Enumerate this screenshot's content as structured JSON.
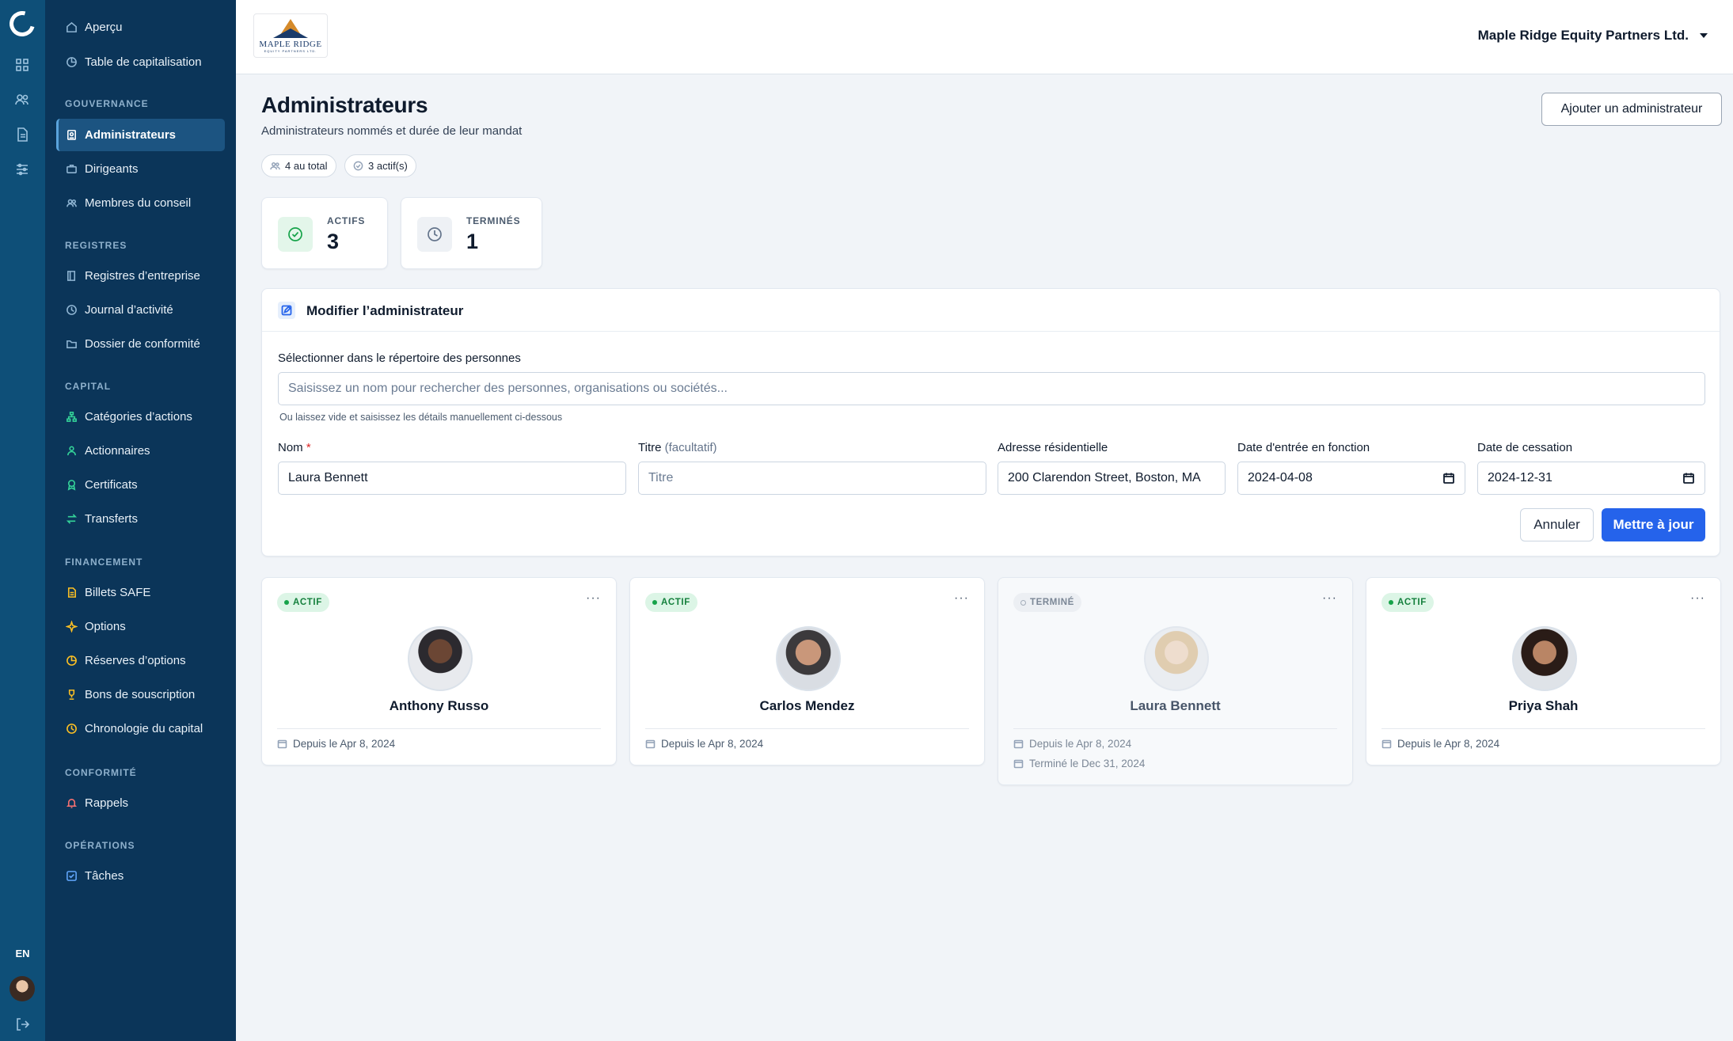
{
  "rail": {
    "lang": "EN"
  },
  "sidebar": {
    "top_items": [
      {
        "label": "Aperçu",
        "icon": "home-icon"
      },
      {
        "label": "Table de capitalisation",
        "icon": "pie-chart-icon"
      }
    ],
    "sections": [
      {
        "title": "GOUVERNANCE",
        "items": [
          {
            "label": "Administrateurs",
            "icon": "id-badge-icon",
            "active": true
          },
          {
            "label": "Dirigeants",
            "icon": "briefcase-icon"
          },
          {
            "label": "Membres du conseil",
            "icon": "users-icon"
          }
        ]
      },
      {
        "title": "REGISTRES",
        "items": [
          {
            "label": "Registres d’entreprise",
            "icon": "book-icon"
          },
          {
            "label": "Journal d’activité",
            "icon": "clock-icon"
          },
          {
            "label": "Dossier de conformité",
            "icon": "folder-icon"
          }
        ]
      },
      {
        "title": "CAPITAL",
        "items": [
          {
            "label": "Catégories d’actions",
            "icon": "hierarchy-icon"
          },
          {
            "label": "Actionnaires",
            "icon": "user-group-icon"
          },
          {
            "label": "Certificats",
            "icon": "award-icon"
          },
          {
            "label": "Transferts",
            "icon": "transfer-icon"
          }
        ]
      },
      {
        "title": "FINANCEMENT",
        "items": [
          {
            "label": "Billets SAFE",
            "icon": "document-icon"
          },
          {
            "label": "Options",
            "icon": "sparkle-icon"
          },
          {
            "label": "Réserves d’options",
            "icon": "pie-chart-icon"
          },
          {
            "label": "Bons de souscription",
            "icon": "trophy-icon"
          },
          {
            "label": "Chronologie du capital",
            "icon": "clock-icon"
          }
        ]
      },
      {
        "title": "CONFORMITÉ",
        "items": [
          {
            "label": "Rappels",
            "icon": "bell-icon"
          }
        ]
      },
      {
        "title": "OPÉRATIONS",
        "items": [
          {
            "label": "Tâches",
            "icon": "checkbox-icon"
          }
        ]
      }
    ]
  },
  "topbar": {
    "logo_text": "MAPLE RIDGE",
    "logo_subtext": "EQUITY PARTNERS LTD.",
    "company": "Maple Ridge Equity Partners Ltd."
  },
  "page": {
    "title": "Administrateurs",
    "subtitle": "Administrateurs nommés et durée de leur mandat",
    "chip_total": "4 au total",
    "chip_active": "3 actif(s)",
    "add_button": "Ajouter un administrateur"
  },
  "stats": {
    "active_label": "ACTIFS",
    "active_value": "3",
    "ended_label": "TERMINÉS",
    "ended_value": "1"
  },
  "form": {
    "title": "Modifier l’administrateur",
    "directory_label": "Sélectionner dans le répertoire des personnes",
    "directory_placeholder": "Saisissez un nom pour rechercher des personnes, organisations ou sociétés...",
    "hint": "Ou laissez vide et saisissez les détails manuellement ci-dessous",
    "name_label": "Nom",
    "name_required": "*",
    "name_value": "Laura Bennett",
    "title_label": "Titre",
    "title_optional": "(facultatif)",
    "title_placeholder": "Titre",
    "address_label": "Adresse résidentielle",
    "address_value": "200 Clarendon Street, Boston, MA",
    "start_label": "Date d'entrée en fonction",
    "start_value": "2024-04-08",
    "end_label": "Date de cessation",
    "end_value": "2024-12-31",
    "cancel": "Annuler",
    "update": "Mettre à jour"
  },
  "directors": [
    {
      "name": "Anthony Russo",
      "status": "ACTIF",
      "since": "Depuis le Apr 8, 2024"
    },
    {
      "name": "Carlos Mendez",
      "status": "ACTIF",
      "since": "Depuis le Apr 8, 2024"
    },
    {
      "name": "Laura Bennett",
      "status": "TERMINÉ",
      "since": "Depuis le Apr 8, 2024",
      "ended": "Terminé le Dec 31, 2024"
    },
    {
      "name": "Priya Shah",
      "status": "ACTIF",
      "since": "Depuis le Apr 8, 2024"
    }
  ],
  "colors": {
    "accent": "#2563eb",
    "sidebar": "#0b3559",
    "rail": "#0e4f78",
    "active_green": "#16a34a"
  }
}
